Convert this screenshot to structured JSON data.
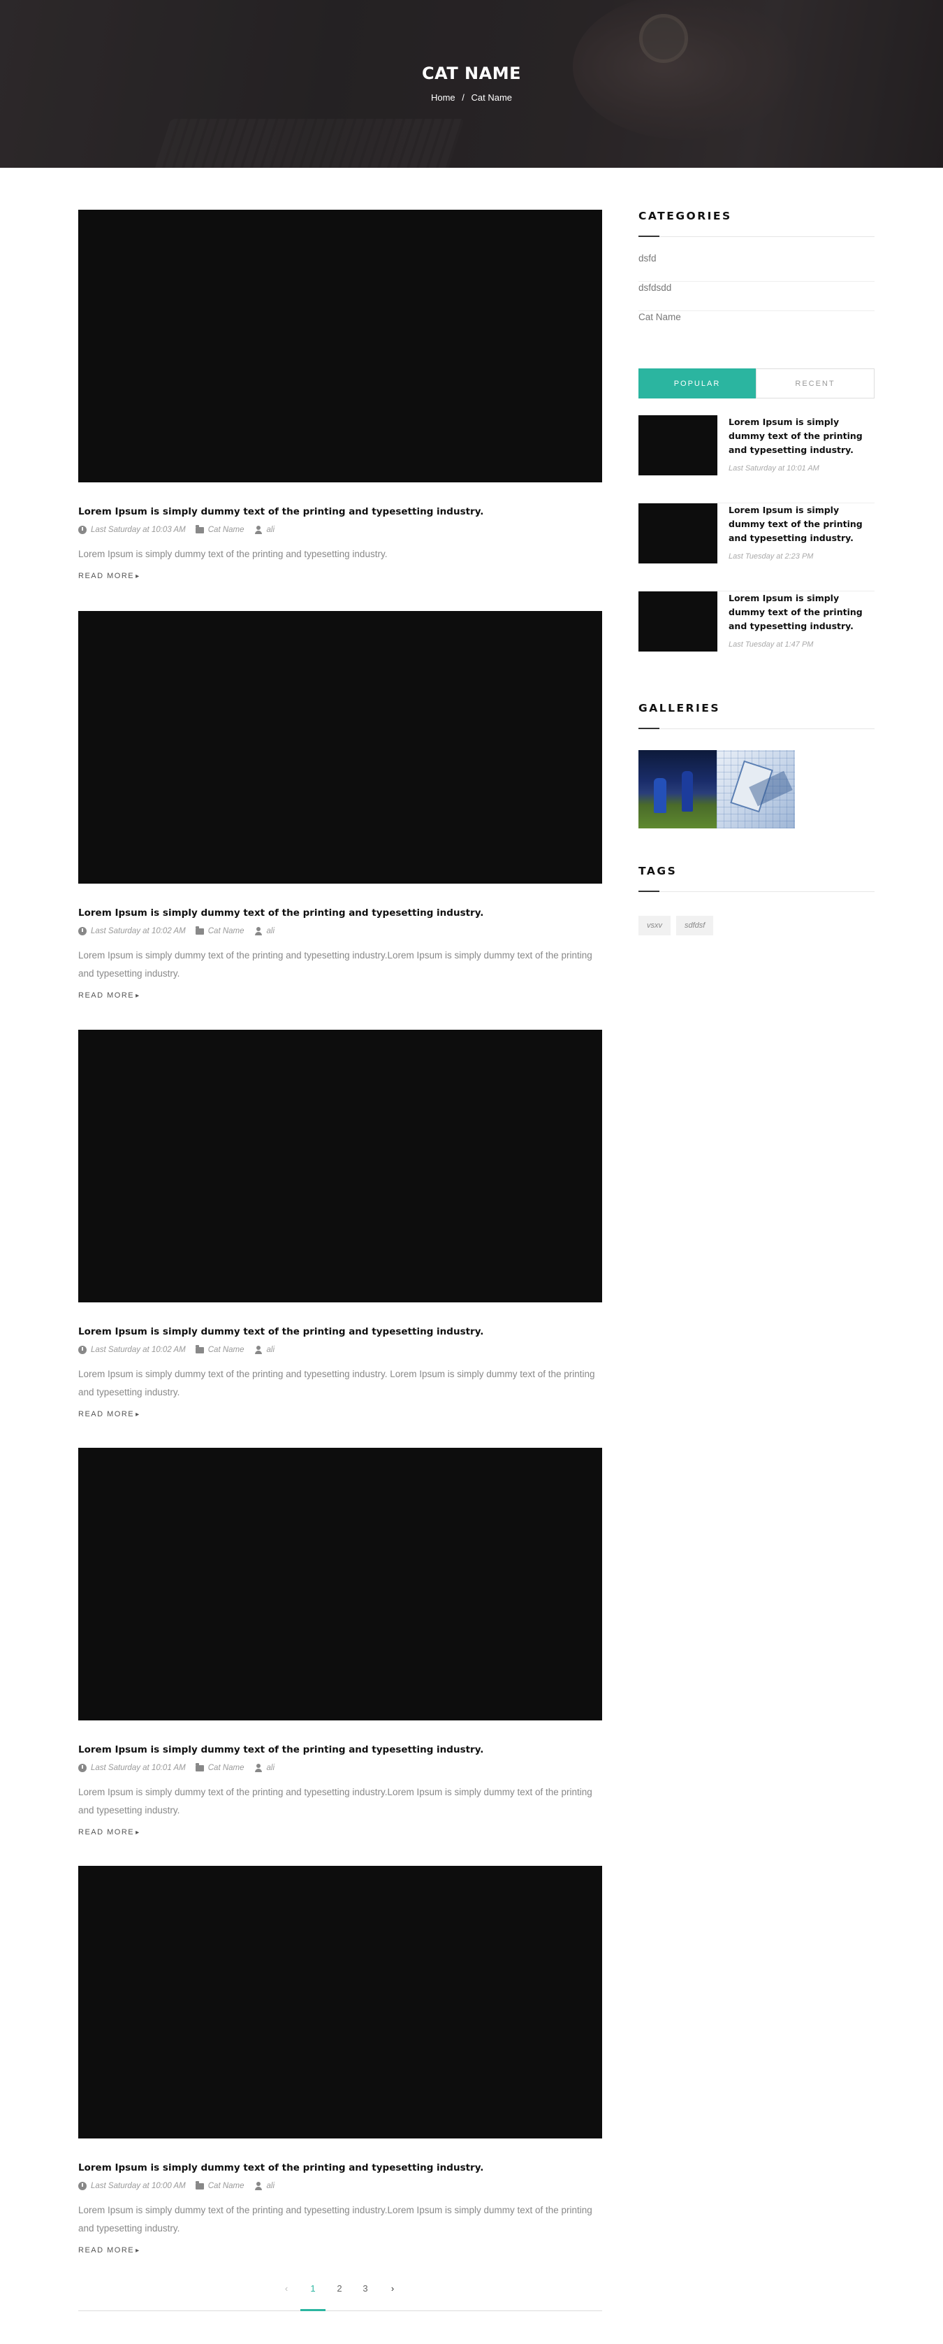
{
  "hero": {
    "title": "CAT NAME",
    "breadcrumb": {
      "home": "Home",
      "separator": "/",
      "current": "Cat Name"
    }
  },
  "posts": [
    {
      "title": "Lorem Ipsum is simply dummy text of the printing and typesetting industry.",
      "date": "Last Saturday at 10:03 AM",
      "category": "Cat Name",
      "author": "ali",
      "excerpt": "Lorem Ipsum is simply dummy text of the printing and typesetting industry.",
      "read_more": "READ MORE"
    },
    {
      "title": "Lorem Ipsum is simply dummy text of the printing and typesetting industry.",
      "date": "Last Saturday at 10:02 AM",
      "category": "Cat Name",
      "author": "ali",
      "excerpt": "Lorem Ipsum is simply dummy text of the printing and typesetting industry.Lorem Ipsum is simply dummy text of the printing and typesetting industry.",
      "read_more": "READ MORE"
    },
    {
      "title": "Lorem Ipsum is simply dummy text of the printing and typesetting industry.",
      "date": "Last Saturday at 10:02 AM",
      "category": "Cat Name",
      "author": "ali",
      "excerpt": "Lorem Ipsum is simply dummy text of the printing and typesetting industry. Lorem Ipsum is simply dummy text of the printing and typesetting industry.",
      "read_more": "READ MORE"
    },
    {
      "title": "Lorem Ipsum is simply dummy text of the printing and typesetting industry.",
      "date": "Last Saturday at 10:01 AM",
      "category": "Cat Name",
      "author": "ali",
      "excerpt": "Lorem Ipsum is simply dummy text of the printing and typesetting industry.Lorem Ipsum is simply dummy text of the printing and typesetting industry.",
      "read_more": "READ MORE"
    },
    {
      "title": "Lorem Ipsum is simply dummy text of the printing and typesetting industry.",
      "date": "Last Saturday at 10:00 AM",
      "category": "Cat Name",
      "author": "ali",
      "excerpt": "Lorem Ipsum is simply dummy text of the printing and typesetting industry.Lorem Ipsum is simply dummy text of the printing and typesetting industry.",
      "read_more": "READ MORE"
    }
  ],
  "pagination": {
    "prev": "‹",
    "pages": [
      "1",
      "2",
      "3"
    ],
    "next": "›",
    "active": "1"
  },
  "sidebar": {
    "categories_title": "CATEGORIES",
    "categories": [
      "dsfd",
      "dsfdsdd",
      "Cat Name"
    ],
    "tabs": {
      "popular": "POPULAR",
      "recent": "RECENT",
      "active": "popular"
    },
    "popular_posts": [
      {
        "title": "Lorem Ipsum is simply dummy text of the printing and typesetting industry.",
        "date": "Last Saturday at 10:01 AM"
      },
      {
        "title": "Lorem Ipsum is simply dummy text of the printing and typesetting industry.",
        "date": "Last Tuesday at 2:23 PM"
      },
      {
        "title": "Lorem Ipsum is simply dummy text of the printing and typesetting industry.",
        "date": "Last Tuesday at 1:47 PM"
      }
    ],
    "galleries_title": "GALLERIES",
    "tags_title": "TAGS",
    "tags": [
      "vsxv",
      "sdfdsf"
    ]
  },
  "colors": {
    "accent": "#2bb5a0",
    "thumb": "#0d0d0d"
  }
}
